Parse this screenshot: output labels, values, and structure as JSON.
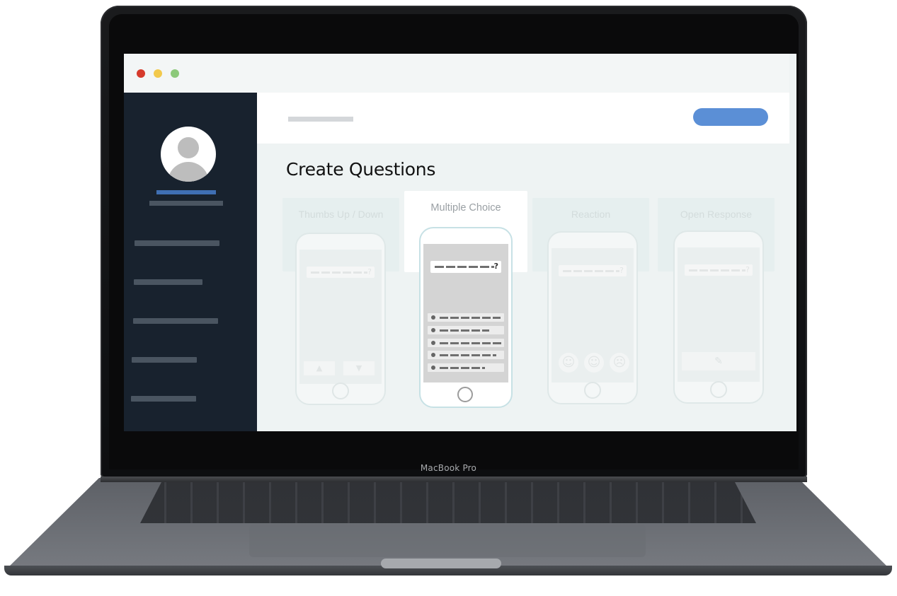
{
  "device": {
    "brand_label": "MacBook Pro"
  },
  "window": {
    "controls": [
      "close",
      "minimize",
      "maximize"
    ],
    "colors": {
      "close": "#d63b2c",
      "minimize": "#f2c94c",
      "maximize": "#8cc97a"
    }
  },
  "sidebar": {
    "background": "#18222e",
    "avatar_icon": "user-avatar-icon",
    "nav_item_count": 5
  },
  "header": {
    "primary_button_color": "#5b8fd6"
  },
  "main": {
    "title": "Create Questions",
    "question_types": [
      {
        "label": "Thumbs Up / Down",
        "selected": false,
        "icons": [
          "thumbs-up-icon",
          "thumbs-down-icon"
        ]
      },
      {
        "label": "Multiple Choice",
        "selected": true,
        "question_mark": "?",
        "choice_count": 5
      },
      {
        "label": "Reaction",
        "selected": false,
        "icons": [
          "smile-icon",
          "surprised-icon",
          "frown-icon"
        ]
      },
      {
        "label": "Open Response",
        "selected": false,
        "icons": [
          "pencil-icon"
        ]
      }
    ],
    "question_mark": "?"
  }
}
